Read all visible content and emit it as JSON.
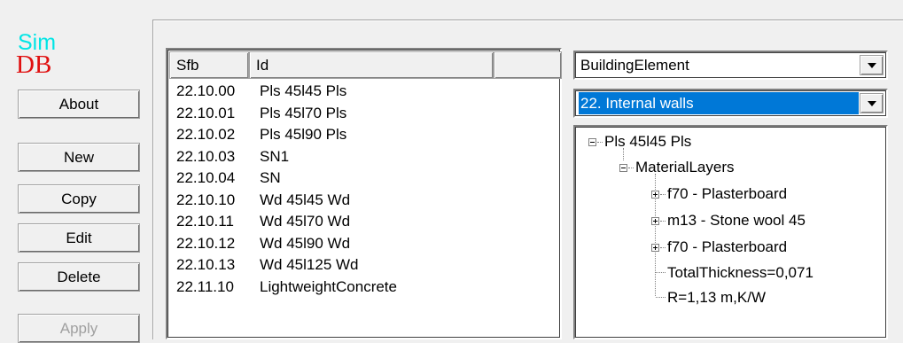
{
  "logo": {
    "line1": "Sim",
    "line2": "DB"
  },
  "buttons": [
    {
      "label": "About",
      "enabled": true
    },
    {
      "label": "New",
      "enabled": true
    },
    {
      "label": "Copy",
      "enabled": true
    },
    {
      "label": "Edit",
      "enabled": true
    },
    {
      "label": "Delete",
      "enabled": true
    },
    {
      "label": "Apply",
      "enabled": false
    }
  ],
  "list": {
    "columns": [
      "Sfb",
      "Id",
      ""
    ],
    "rows": [
      {
        "sfb": "22.10.00",
        "id": "Pls 45l45 Pls"
      },
      {
        "sfb": "22.10.01",
        "id": "Pls 45l70 Pls"
      },
      {
        "sfb": "22.10.02",
        "id": "Pls 45l90 Pls"
      },
      {
        "sfb": "22.10.03",
        "id": "SN1"
      },
      {
        "sfb": "22.10.04",
        "id": "SN"
      },
      {
        "sfb": "22.10.10",
        "id": "Wd 45l45 Wd"
      },
      {
        "sfb": "22.10.11",
        "id": "Wd 45l70 Wd"
      },
      {
        "sfb": "22.10.12",
        "id": "Wd 45l90 Wd"
      },
      {
        "sfb": "22.10.13",
        "id": "Wd 45l125 Wd"
      },
      {
        "sfb": "22.11.10",
        "id": "LightweightConcrete"
      }
    ]
  },
  "type_select": {
    "value": "BuildingElement"
  },
  "category_select": {
    "value": "22. Internal walls"
  },
  "tree": {
    "root": "Pls 45l45 Pls",
    "group": "MaterialLayers",
    "layers": [
      "f70 - Plasterboard",
      "m13 - Stone wool 45",
      "f70 - Plasterboard"
    ],
    "total_thickness": "TotalThickness=0,071",
    "r_value": "R=1,13 m,K/W"
  },
  "colors": {
    "selection": "#0078d7",
    "logo_sim": "#00e5e5",
    "logo_db": "#e01010"
  }
}
